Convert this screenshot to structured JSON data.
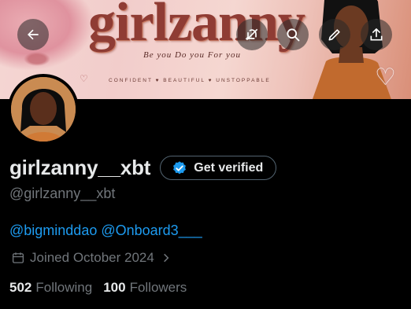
{
  "banner": {
    "brand_text": "girlzanny",
    "script_text": "Be you  Do you  For you",
    "tagline": "CONFIDENT  ♥  BEAUTIFUL  ♥  UNSTOPPABLE"
  },
  "profile": {
    "display_name": "girlzanny__xbt",
    "handle": "@girlzanny__xbt",
    "verify_label": "Get verified",
    "mentions": [
      "@bigminddao",
      "@Onboard3___"
    ],
    "joined": "Joined October 2024",
    "following_count": "502",
    "following_label": "Following",
    "followers_count": "100",
    "followers_label": "Followers"
  },
  "icons": {
    "back": "arrow-left-icon",
    "mute": "bell-off-icon",
    "search": "search-icon",
    "edit": "pencil-icon",
    "share": "share-icon",
    "verified": "verified-badge-icon",
    "calendar": "calendar-icon",
    "chevron": "chevron-right-icon"
  },
  "colors": {
    "background": "#000000",
    "primary_text": "#e7e9ea",
    "secondary_text": "#71767b",
    "link": "#1d9bf0",
    "border": "#536471"
  }
}
